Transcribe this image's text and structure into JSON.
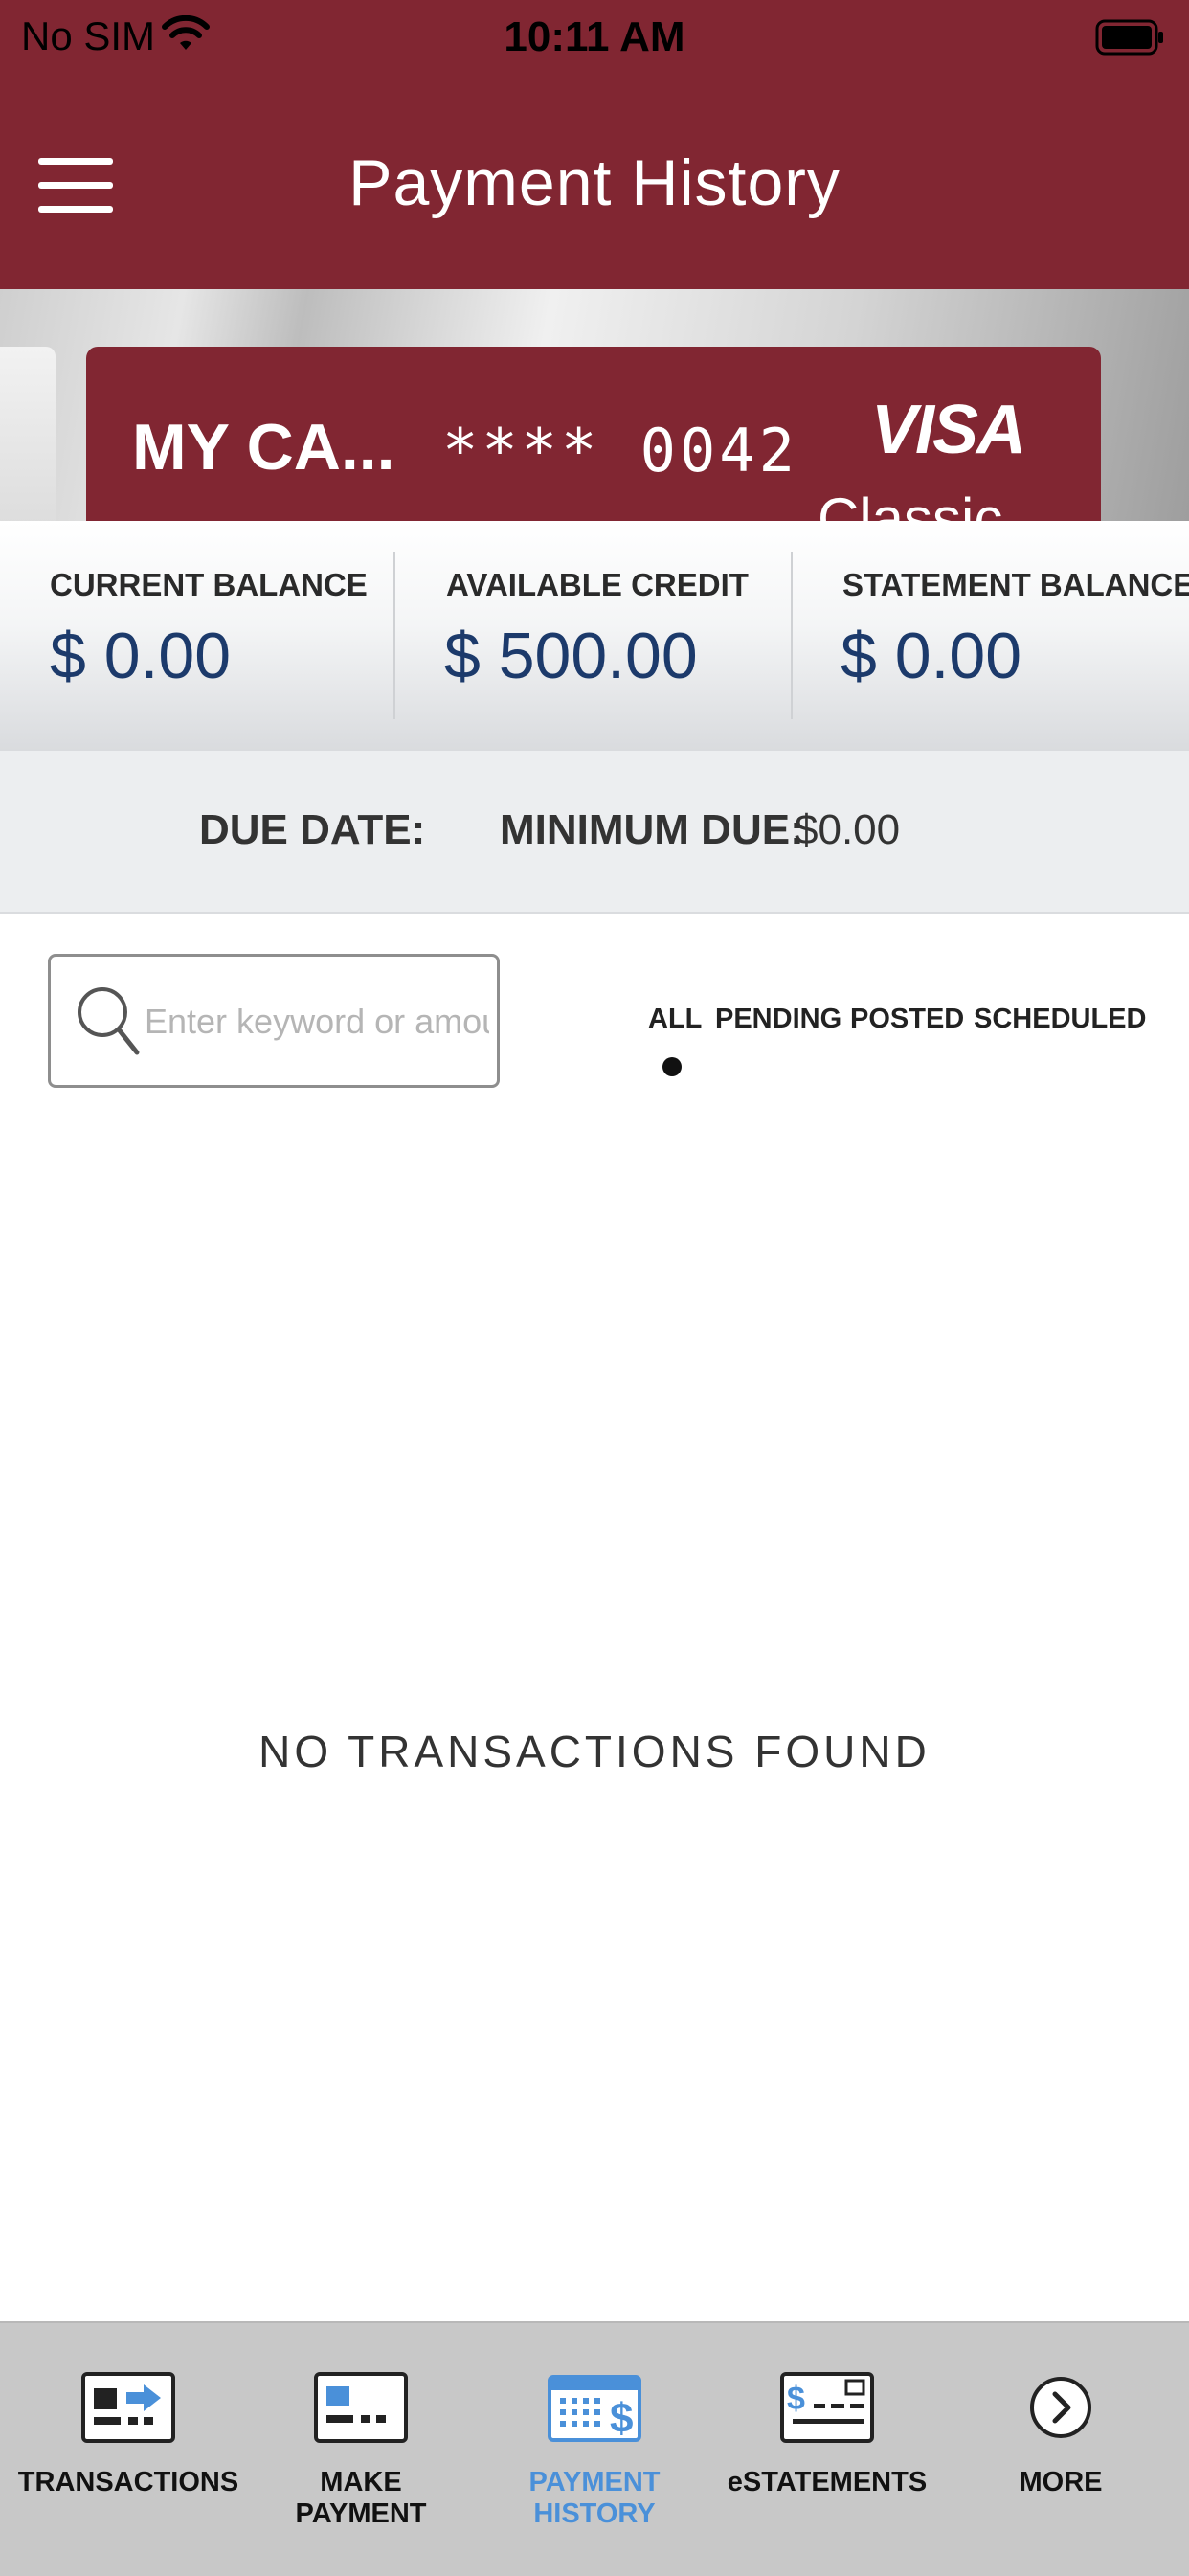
{
  "status_bar": {
    "carrier": "No SIM",
    "time": "10:11 AM"
  },
  "header": {
    "title": "Payment History",
    "menu_icon": "hamburger-menu-icon",
    "background_color": "#812632"
  },
  "card": {
    "name": "MY CA...",
    "number_masked": "**** 0042",
    "brand": "VISA",
    "tier": "Classic",
    "color": "#812632"
  },
  "balances": [
    {
      "label": "CURRENT BALANCE",
      "value": "$ 0.00"
    },
    {
      "label": "AVAILABLE CREDIT",
      "value": "$ 500.00"
    },
    {
      "label": "STATEMENT BALANCE",
      "value": "$ 0.00"
    }
  ],
  "due": {
    "due_date_label": "DUE DATE:",
    "due_date_value": "",
    "minimum_due_label": "MINIMUM DUE:",
    "minimum_due_value": "$0.00"
  },
  "search": {
    "placeholder": "Enter keyword or amount",
    "value": ""
  },
  "filters": {
    "tabs": [
      "ALL",
      "PENDING",
      "POSTED",
      "SCHEDULED"
    ],
    "selected": "ALL"
  },
  "empty_state": {
    "message": "NO TRANSACTIONS FOUND"
  },
  "tabbar": {
    "tabs": [
      {
        "label": "TRANSACTIONS",
        "icon": "transactions-icon"
      },
      {
        "label": "MAKE\nPAYMENT",
        "icon": "make-payment-icon"
      },
      {
        "label": "PAYMENT\nHISTORY",
        "icon": "payment-history-icon",
        "active": true
      },
      {
        "label": "eSTATEMENTS",
        "icon": "estatements-icon"
      },
      {
        "label": "MORE",
        "icon": "more-chevron-icon"
      }
    ],
    "active_color": "#4a90d9"
  }
}
